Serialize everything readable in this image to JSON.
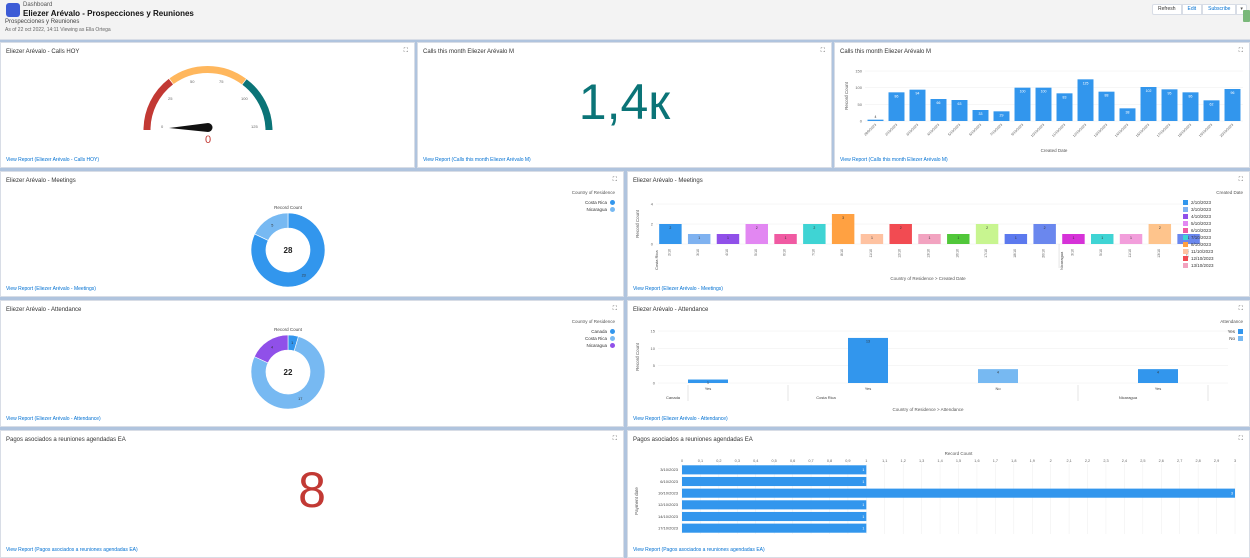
{
  "header": {
    "app_label": "Dashboard",
    "title": "Eliezer Arévalo - Prospecciones y Reuniones",
    "subtitle": "Prospecciones y Reuniones",
    "as_of": "As of 22 oct 2022, 14:11 Viewing as Ella Ortega",
    "buttons": {
      "refresh": "Refresh",
      "edit": "Edit",
      "subscribe": "Subscribe",
      "dropdown": "▾"
    }
  },
  "icons": {
    "expand": "expand-icon",
    "app": "dashboard-icon"
  },
  "colors": {
    "accent": "#0070d2",
    "bar_blue": "#3296ed",
    "bignum_teal": "#0b7477",
    "bignum_red": "#c23934",
    "gauge_red": "#c23934",
    "gauge_orange": "#ffb75d",
    "gauge_teal": "#0b7477"
  },
  "panes": {
    "gauge": {
      "title": "Eliezer Arévalo - Calls HOY",
      "link": "View Report (Eliezer Arévalo - Calls HOY)",
      "value": "0",
      "ticks": [
        "0",
        "25",
        "50",
        "75",
        "100",
        "125"
      ]
    },
    "calls_metric": {
      "title": "Calls this month Eliezer Arévalo M",
      "value": "1,4к",
      "link": "View Report (Calls this month Eliezer Arévalo M)"
    },
    "calls_chart": {
      "title": "Calls this month Eliezer Arévalo M",
      "link": "View Report (Calls this month Eliezer Arévalo M)"
    },
    "meetings_donut": {
      "title": "Eliezer Arévalo - Meetings",
      "link": "View Report (Eliezer Arévalo - Meetings)",
      "label": "Record Count",
      "total": "28",
      "legend_title": "Country of Residence",
      "legend": [
        "Costa Rica",
        "Nicaragua"
      ]
    },
    "meetings_bar": {
      "title": "Eliezer Arévalo - Meetings",
      "link": "View Report (Eliezer Arévalo - Meetings)",
      "legend_title": "Created Date",
      "legend": [
        "2/10/2023",
        "3/10/2023",
        "4/10/2023",
        "5/10/2023",
        "6/10/2023",
        "7/10/2023",
        "8/10/2023",
        "11/10/2023",
        "12/10/2023",
        "13/10/2023"
      ]
    },
    "attendance_donut": {
      "title": "Eliezer Arévalo - Attendance",
      "link": "View Report (Eliezer Arévalo - Attendance)",
      "label": "Record Count",
      "total": "22",
      "legend_title": "Country of Residence",
      "legend": [
        "Canada",
        "Costa Rica",
        "Nicaragua"
      ]
    },
    "attendance_bar": {
      "title": "Eliezer Arévalo - Attendance",
      "link": "View Report (Eliezer Arévalo - Attendance)",
      "legend_title": "Attendance",
      "legend": [
        "Yes",
        "No"
      ]
    },
    "pagos_metric": {
      "title": "Pagos asociados a reuniones agendadas EA",
      "value": "8",
      "link": "View Report (Pagos asociados a reuniones agendadas EA)"
    },
    "pagos_bar": {
      "title": "Pagos asociados a reuniones agendadas EA",
      "link": "View Report (Pagos asociados a reuniones agendadas EA)"
    }
  },
  "chart_data": [
    {
      "id": "calls_chart",
      "type": "bar",
      "categories": [
        "28/9/2023",
        "2/10/2023",
        "3/10/2023",
        "4/10/2023",
        "5/10/2023",
        "6/10/2023",
        "7/10/2023",
        "9/10/2023",
        "10/10/2023",
        "11/10/2023",
        "12/10/2023",
        "13/10/2023",
        "14/10/2023",
        "16/10/2023",
        "17/10/2023",
        "18/10/2023",
        "19/10/2023",
        "20/10/2023"
      ],
      "values": [
        4,
        86,
        94,
        66,
        63,
        33,
        29,
        100,
        100,
        83,
        125,
        88,
        38,
        102,
        95,
        86,
        62,
        96
      ],
      "xlabel": "Created Date",
      "ylabel": "Record Count",
      "ylim": [
        0,
        150
      ],
      "yticks": [
        0,
        50,
        100,
        150
      ],
      "color": "#3296ed"
    },
    {
      "id": "meetings_donut",
      "type": "pie",
      "categories": [
        "Costa Rica",
        "Nicaragua"
      ],
      "values": [
        23,
        5
      ],
      "colors": [
        "#3296ed",
        "#77b9f2"
      ]
    },
    {
      "id": "meetings_bar",
      "type": "bar",
      "group_labels": [
        "Costa Rica",
        "Nicaragua"
      ],
      "tick_labels": [
        "2/10",
        "3/10",
        "4/10",
        "5/10",
        "6/10",
        "7/10",
        "8/10",
        "11/10",
        "12/10",
        "13/10",
        "16/10",
        "17/10",
        "18/10",
        "20/10",
        "3/10",
        "5/10",
        "11/10",
        "13/10",
        "17/10"
      ],
      "values": [
        2,
        1,
        1,
        2,
        1,
        2,
        3,
        1,
        2,
        1,
        1,
        2,
        1,
        2,
        1,
        1,
        1,
        2,
        1
      ],
      "colors": [
        "#3296ed",
        "#7fb2f0",
        "#9050e9",
        "#e287f2",
        "#f05aa2",
        "#3fd4d4",
        "#ffa142",
        "#fec2a1",
        "#f24b52",
        "#f2a3c0",
        "#51c73a",
        "#c8f590",
        "#5c79ee",
        "#6a87ee",
        "#d632d8",
        "#3fd4d4",
        "#f29edb",
        "#fec48c",
        "#6a87ee"
      ],
      "xlabel": "Country of Residence > Created Date",
      "ylabel": "Record Count",
      "ylim": [
        0,
        4
      ],
      "yticks": [
        0,
        2,
        4
      ]
    },
    {
      "id": "attendance_donut",
      "type": "pie",
      "categories": [
        "Canada",
        "Costa Rica",
        "Nicaragua"
      ],
      "values": [
        1,
        17,
        4
      ],
      "colors": [
        "#3296ed",
        "#77b9f2",
        "#9050e9"
      ]
    },
    {
      "id": "attendance_bar",
      "type": "bar",
      "group_labels": [
        "Canada",
        "Costa Rica",
        "Nicaragua"
      ],
      "bar_labels": [
        "Yes",
        "Yes",
        "No",
        "Yes"
      ],
      "values": [
        1,
        13,
        4,
        4
      ],
      "colors": [
        "#3296ed",
        "#3296ed",
        "#77b9f2",
        "#3296ed"
      ],
      "xlabel": "Country of Residence > Attendance",
      "ylabel": "Record Count",
      "ylim": [
        0,
        15
      ],
      "yticks": [
        0,
        5,
        10,
        15
      ]
    },
    {
      "id": "pagos_bar",
      "type": "bar",
      "orientation": "horizontal",
      "categories": [
        "3/10/2023",
        "6/10/2023",
        "10/10/2023",
        "12/10/2023",
        "14/10/2023",
        "17/10/2023"
      ],
      "values": [
        1,
        1,
        3,
        1,
        1,
        1
      ],
      "xlabel": "Record Count",
      "ylabel": "Payment date",
      "xlim": [
        0,
        3
      ],
      "xticks": [
        "0",
        "0,1",
        "0,2",
        "0,3",
        "0,4",
        "0,5",
        "0,6",
        "0,7",
        "0,8",
        "0,9",
        "1",
        "1,1",
        "1,2",
        "1,3",
        "1,4",
        "1,5",
        "1,6",
        "1,7",
        "1,8",
        "1,9",
        "2",
        "2,1",
        "2,2",
        "2,3",
        "2,4",
        "2,5",
        "2,6",
        "2,7",
        "2,8",
        "2,9",
        "3"
      ],
      "color": "#3296ed"
    }
  ]
}
